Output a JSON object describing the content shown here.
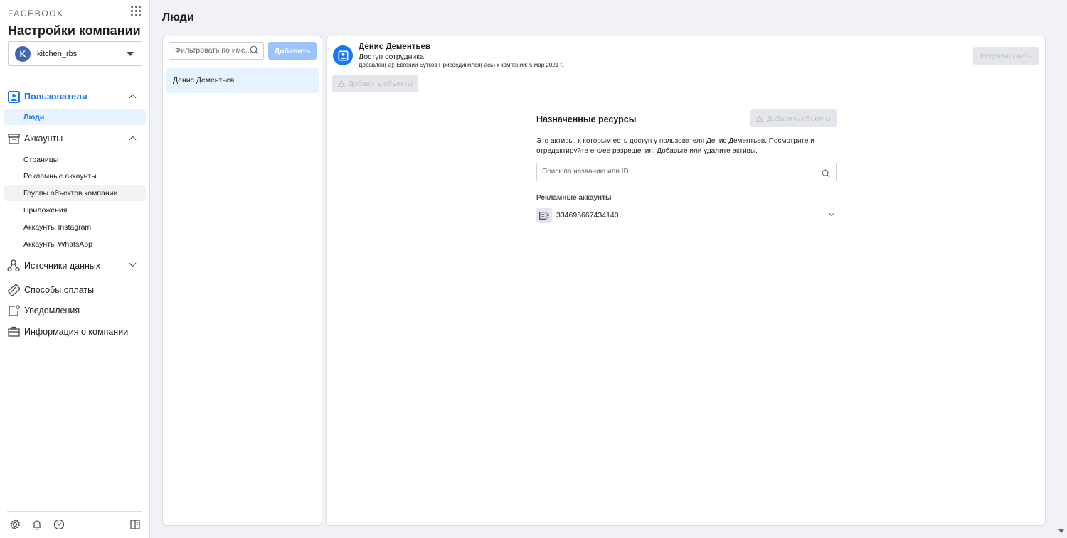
{
  "brand": "FACEBOOK",
  "sidebar": {
    "title": "Настройки компании",
    "account": {
      "initial": "K",
      "name": "kitchen_rbs"
    },
    "sections": {
      "users": "Пользователи",
      "people": "Люди",
      "accounts": "Аккаунты",
      "pages": "Страницы",
      "ad_accounts": "Рекламные аккаунты",
      "asset_groups": "Группы объектов компании",
      "apps": "Приложения",
      "instagram": "Аккаунты Instagram",
      "whatsapp": "Аккаунты WhatsApp",
      "data_sources": "Источники данных",
      "payment": "Способы оплаты",
      "notifications": "Уведомления",
      "company_info": "Информация о компании"
    }
  },
  "main": {
    "heading": "Люди",
    "list": {
      "filter_placeholder": "Фильтровать по име...",
      "add_label": "Добавить",
      "people": [
        "Денис Дементьев"
      ]
    },
    "detail": {
      "name": "Денис Дементьев",
      "role": "Доступ сотрудника",
      "meta": "Добавлен(-а): Евгений Бутков   Присоединился(-ась) к компании: 5 мар 2021 г.",
      "edit_label": "Редактировать",
      "add_objects_label": "Добавить объекты",
      "assets": {
        "title": "Назначенные ресурсы",
        "add_label": "Добавить объекты",
        "description": "Это активы, к которым есть доступ у пользователя Денис Дементьев. Посмотрите и отредактируйте его/ее разрешения. Добавьте или удалите активы.",
        "search_placeholder": "Поиск по названию или ID",
        "ad_accounts_label": "Рекламные аккаунты",
        "ad_account_id": "334695667434140"
      }
    }
  },
  "colors": {
    "accent": "#1877f2",
    "active_bg": "#e7f3ff",
    "disabled_bg": "#e4e6eb"
  }
}
